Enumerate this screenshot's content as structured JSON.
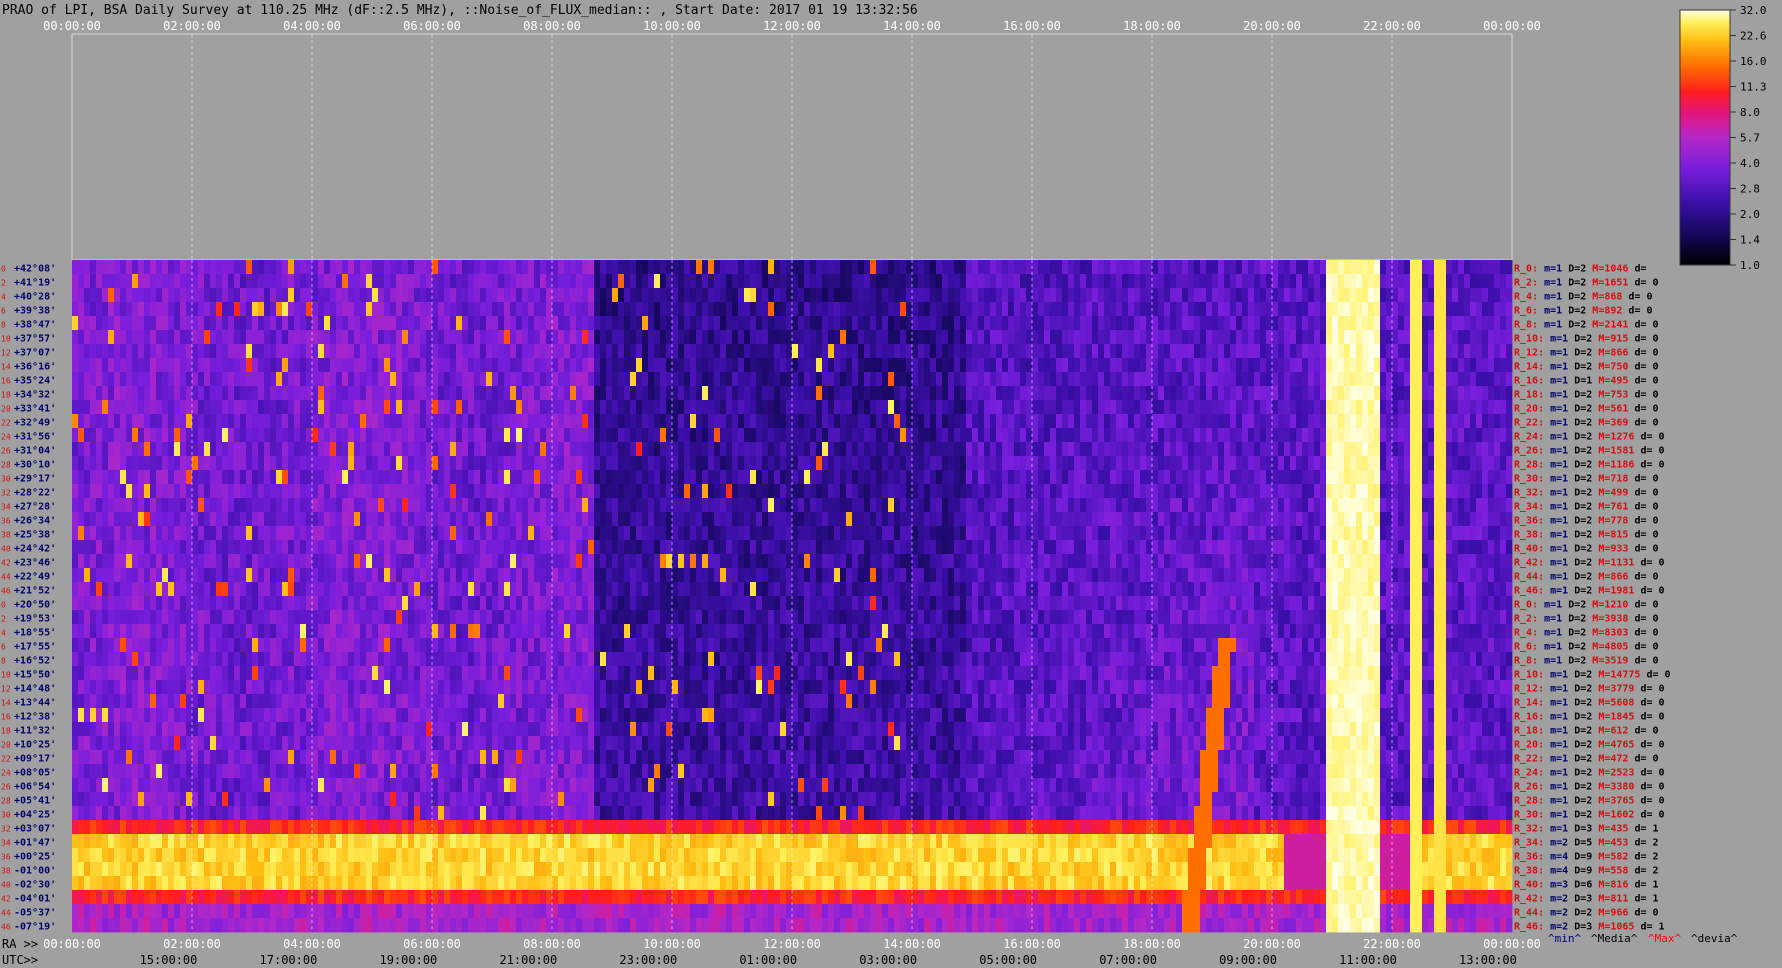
{
  "title": "PRAO of LPI, BSA Daily Survey at 110.25 MHz (dF::2.5 MHz), ::Noise_of_FLUX_median:: , Start Date: 2017 01 19 13:32:56",
  "top_axis_ticks": [
    "00:00:00",
    "02:00:00",
    "04:00:00",
    "06:00:00",
    "08:00:00",
    "10:00:00",
    "12:00:00",
    "14:00:00",
    "16:00:00",
    "18:00:00",
    "20:00:00",
    "22:00:00",
    "00:00:00"
  ],
  "ra_axis_label": "RA >>",
  "ra_axis_ticks": [
    "00:00:00",
    "02:00:00",
    "04:00:00",
    "06:00:00",
    "08:00:00",
    "10:00:00",
    "12:00:00",
    "14:00:00",
    "16:00:00",
    "18:00:00",
    "20:00:00",
    "22:00:00",
    "00:00:00"
  ],
  "utc_axis_label": "UTC>>",
  "utc_axis_ticks": [
    "15:00:00",
    "17:00:00",
    "19:00:00",
    "21:00:00",
    "23:00:00",
    "01:00:00",
    "03:00:00",
    "05:00:00",
    "07:00:00",
    "09:00:00",
    "11:00:00",
    "13:00:00"
  ],
  "bottom_legend": [
    {
      "text": "^min^",
      "color": "#000080"
    },
    {
      "text": "^Media^",
      "color": "#000000"
    },
    {
      "text": "^Max^",
      "color": "#ff0000"
    },
    {
      "text": "^devia^",
      "color": "#000000"
    }
  ],
  "colorbar": {
    "ticks": [
      "32.0",
      "22.6",
      "16.0",
      "11.3",
      "8.0",
      "5.7",
      "4.0",
      "2.8",
      "2.0",
      "1.4",
      "1.0"
    ],
    "colors": [
      "#000000",
      "#1a0a6e",
      "#4a10c0",
      "#8a20e0",
      "#c028c0",
      "#e81080",
      "#ff2020",
      "#ff6000",
      "#ffa000",
      "#ffe040",
      "#ffffe0"
    ]
  },
  "chart_data": {
    "type": "heatmap",
    "title": "PRAO of LPI, BSA Daily Survey at 110.25 MHz (dF::2.5 MHz), ::Noise_of_FLUX_median:: , Start Date: 2017 01 19 13:32:56",
    "xlabel": "RA >>",
    "x_range": [
      "00:00:00",
      "00:00:00"
    ],
    "color_scale": "log",
    "color_range": [
      1.0,
      32.0
    ],
    "rows": [
      {
        "index": 0,
        "dec": "+42°08'",
        "label": "R_0:",
        "min": "1",
        "D": "2",
        "M": "1046",
        "d": ""
      },
      {
        "index": 2,
        "dec": "+41°19'",
        "label": "R_2:",
        "min": "1",
        "D": "2",
        "M": "1651",
        "d": "0"
      },
      {
        "index": 4,
        "dec": "+40°28'",
        "label": "R_4:",
        "min": "1",
        "D": "2",
        "M": "868",
        "d": "0"
      },
      {
        "index": 6,
        "dec": "+39°38'",
        "label": "R_6:",
        "min": "1",
        "D": "2",
        "M": "892",
        "d": "0"
      },
      {
        "index": 8,
        "dec": "+38°47'",
        "label": "R_8:",
        "min": "1",
        "D": "2",
        "M": "2141",
        "d": "0"
      },
      {
        "index": 10,
        "dec": "+37°57'",
        "label": "R_10:",
        "min": "1",
        "D": "2",
        "M": "915",
        "d": "0"
      },
      {
        "index": 12,
        "dec": "+37°07'",
        "label": "R_12:",
        "min": "1",
        "D": "2",
        "M": "866",
        "d": "0"
      },
      {
        "index": 14,
        "dec": "+36°16'",
        "label": "R_14:",
        "min": "1",
        "D": "2",
        "M": "750",
        "d": "0"
      },
      {
        "index": 16,
        "dec": "+35°24'",
        "label": "R_16:",
        "min": "1",
        "D": "1",
        "M": "495",
        "d": "0"
      },
      {
        "index": 18,
        "dec": "+34°32'",
        "label": "R_18:",
        "min": "1",
        "D": "2",
        "M": "753",
        "d": "0"
      },
      {
        "index": 20,
        "dec": "+33°41'",
        "label": "R_20:",
        "min": "1",
        "D": "2",
        "M": "561",
        "d": "0"
      },
      {
        "index": 22,
        "dec": "+32°49'",
        "label": "R_22:",
        "min": "1",
        "D": "2",
        "M": "369",
        "d": "0"
      },
      {
        "index": 24,
        "dec": "+31°56'",
        "label": "R_24:",
        "min": "1",
        "D": "2",
        "M": "1276",
        "d": "0"
      },
      {
        "index": 26,
        "dec": "+31°04'",
        "label": "R_26:",
        "min": "1",
        "D": "2",
        "M": "1581",
        "d": "0"
      },
      {
        "index": 28,
        "dec": "+30°10'",
        "label": "R_28:",
        "min": "1",
        "D": "2",
        "M": "1186",
        "d": "0"
      },
      {
        "index": 30,
        "dec": "+29°17'",
        "label": "R_30:",
        "min": "1",
        "D": "2",
        "M": "718",
        "d": "0"
      },
      {
        "index": 32,
        "dec": "+28°22'",
        "label": "R_32:",
        "min": "1",
        "D": "2",
        "M": "499",
        "d": "0"
      },
      {
        "index": 34,
        "dec": "+27°28'",
        "label": "R_34:",
        "min": "1",
        "D": "2",
        "M": "761",
        "d": "0"
      },
      {
        "index": 36,
        "dec": "+26°34'",
        "label": "R_36:",
        "min": "1",
        "D": "2",
        "M": "778",
        "d": "0"
      },
      {
        "index": 38,
        "dec": "+25°38'",
        "label": "R_38:",
        "min": "1",
        "D": "2",
        "M": "815",
        "d": "0"
      },
      {
        "index": 40,
        "dec": "+24°42'",
        "label": "R_40:",
        "min": "1",
        "D": "2",
        "M": "933",
        "d": "0"
      },
      {
        "index": 42,
        "dec": "+23°46'",
        "label": "R_42:",
        "min": "1",
        "D": "2",
        "M": "1131",
        "d": "0"
      },
      {
        "index": 44,
        "dec": "+22°49'",
        "label": "R_44:",
        "min": "1",
        "D": "2",
        "M": "866",
        "d": "0"
      },
      {
        "index": 46,
        "dec": "+21°52'",
        "label": "R_46:",
        "min": "1",
        "D": "2",
        "M": "1981",
        "d": "0"
      },
      {
        "index": 0,
        "dec": "+20°50'",
        "label": "R_0:",
        "min": "1",
        "D": "2",
        "M": "1210",
        "d": "0"
      },
      {
        "index": 2,
        "dec": "+19°53'",
        "label": "R_2:",
        "min": "1",
        "D": "2",
        "M": "3938",
        "d": "0"
      },
      {
        "index": 4,
        "dec": "+18°55'",
        "label": "R_4:",
        "min": "1",
        "D": "2",
        "M": "8303",
        "d": "0"
      },
      {
        "index": 6,
        "dec": "+17°55'",
        "label": "R_6:",
        "min": "1",
        "D": "2",
        "M": "4805",
        "d": "0"
      },
      {
        "index": 8,
        "dec": "+16°52'",
        "label": "R_8:",
        "min": "1",
        "D": "2",
        "M": "3519",
        "d": "0"
      },
      {
        "index": 10,
        "dec": "+15°50'",
        "label": "R_10:",
        "min": "1",
        "D": "2",
        "M": "14775",
        "d": "0"
      },
      {
        "index": 12,
        "dec": "+14°48'",
        "label": "R_12:",
        "min": "1",
        "D": "2",
        "M": "3779",
        "d": "0"
      },
      {
        "index": 14,
        "dec": "+13°44'",
        "label": "R_14:",
        "min": "1",
        "D": "2",
        "M": "5608",
        "d": "0"
      },
      {
        "index": 16,
        "dec": "+12°38'",
        "label": "R_16:",
        "min": "1",
        "D": "2",
        "M": "1845",
        "d": "0"
      },
      {
        "index": 18,
        "dec": "+11°32'",
        "label": "R_18:",
        "min": "1",
        "D": "2",
        "M": "612",
        "d": "0"
      },
      {
        "index": 20,
        "dec": "+10°25'",
        "label": "R_20:",
        "min": "1",
        "D": "2",
        "M": "4765",
        "d": "0"
      },
      {
        "index": 22,
        "dec": "+09°17'",
        "label": "R_22:",
        "min": "1",
        "D": "2",
        "M": "472",
        "d": "0"
      },
      {
        "index": 24,
        "dec": "+08°05'",
        "label": "R_24:",
        "min": "1",
        "D": "2",
        "M": "2523",
        "d": "0"
      },
      {
        "index": 26,
        "dec": "+06°54'",
        "label": "R_26:",
        "min": "1",
        "D": "2",
        "M": "3380",
        "d": "0"
      },
      {
        "index": 28,
        "dec": "+05°41'",
        "label": "R_28:",
        "min": "1",
        "D": "2",
        "M": "3765",
        "d": "0"
      },
      {
        "index": 30,
        "dec": "+04°25'",
        "label": "R_30:",
        "min": "1",
        "D": "2",
        "M": "1602",
        "d": "0"
      },
      {
        "index": 32,
        "dec": "+03°07'",
        "label": "R_32:",
        "min": "1",
        "D": "3",
        "M": "435",
        "d": "1"
      },
      {
        "index": 34,
        "dec": "+01°47'",
        "label": "R_34:",
        "min": "2",
        "D": "5",
        "M": "453",
        "d": "2"
      },
      {
        "index": 36,
        "dec": "+00°25'",
        "label": "R_36:",
        "min": "4",
        "D": "9",
        "M": "582",
        "d": "2"
      },
      {
        "index": 38,
        "dec": "-01°00'",
        "label": "R_38:",
        "min": "4",
        "D": "9",
        "M": "558",
        "d": "2"
      },
      {
        "index": 40,
        "dec": "-02°30'",
        "label": "R_40:",
        "min": "3",
        "D": "6",
        "M": "816",
        "d": "1"
      },
      {
        "index": 42,
        "dec": "-04°01'",
        "label": "R_42:",
        "min": "2",
        "D": "3",
        "M": "811",
        "d": "1"
      },
      {
        "index": 44,
        "dec": "-05°37'",
        "label": "R_44:",
        "min": "2",
        "D": "2",
        "M": "966",
        "d": "0"
      },
      {
        "index": 46,
        "dec": "-07°19'",
        "label": "R_46:",
        "min": "2",
        "D": "3",
        "M": "1065",
        "d": "1"
      }
    ]
  }
}
